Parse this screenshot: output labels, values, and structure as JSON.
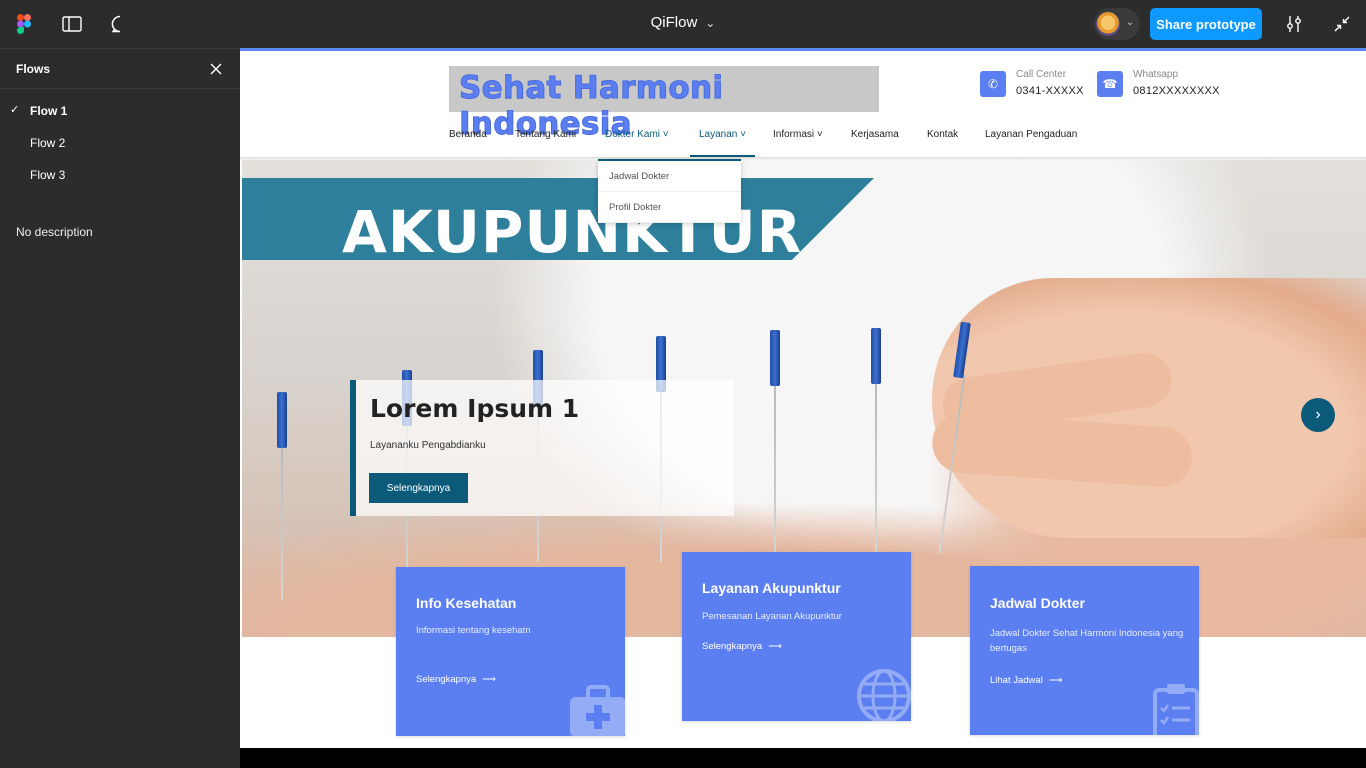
{
  "figma": {
    "title": "QiFlow",
    "share_label": "Share prototype",
    "panel_title": "Flows",
    "flows": [
      {
        "label": "Flow 1",
        "selected": true
      },
      {
        "label": "Flow 2",
        "selected": false
      },
      {
        "label": "Flow 3",
        "selected": false
      }
    ],
    "description": "No description"
  },
  "site": {
    "logo": "Sehat Harmoni Indonesia",
    "contacts": [
      {
        "label": "Call Center",
        "value": "0341-XXXXX",
        "icon": "phone-icon"
      },
      {
        "label": "Whatsapp",
        "value": "0812XXXXXXXX",
        "icon": "whatsapp-icon"
      }
    ],
    "nav": [
      {
        "label": "Beranda"
      },
      {
        "label": "Tentang Kami"
      },
      {
        "label": "Dokter Kami",
        "dropdown": true
      },
      {
        "label": "Layanan",
        "dropdown": true
      },
      {
        "label": "Informasi",
        "dropdown": true
      },
      {
        "label": "Kerjasama"
      },
      {
        "label": "Kontak"
      },
      {
        "label": "Layanan Pengaduan"
      }
    ],
    "dropdown_items": [
      "Jadwal Dokter",
      "Profil Dokter"
    ],
    "hero": {
      "banner": "AKUPUNKTUR",
      "title": "Lorem Ipsum 1",
      "subtitle": "Layananku Pengabdianku",
      "button": "Selengkapnya"
    },
    "cards": [
      {
        "title": "Info Kesehatan",
        "desc": "Informasi tentang kesehatn",
        "link": "Selengkapnya"
      },
      {
        "title": "Layanan Akupunktur",
        "desc": "Pemesanan Layanan Akupunktur",
        "link": "Selengkapnya"
      },
      {
        "title": "Jadwal Dokter",
        "desc": "Jadwal Dokter Sehat Harmoni Indonesia yang bertugas",
        "link": "Lihat Jadwal"
      }
    ]
  },
  "colors": {
    "figma_blue": "#0d99ff",
    "site_accent": "#0b5a7a",
    "card_blue": "#5b7ff0"
  }
}
